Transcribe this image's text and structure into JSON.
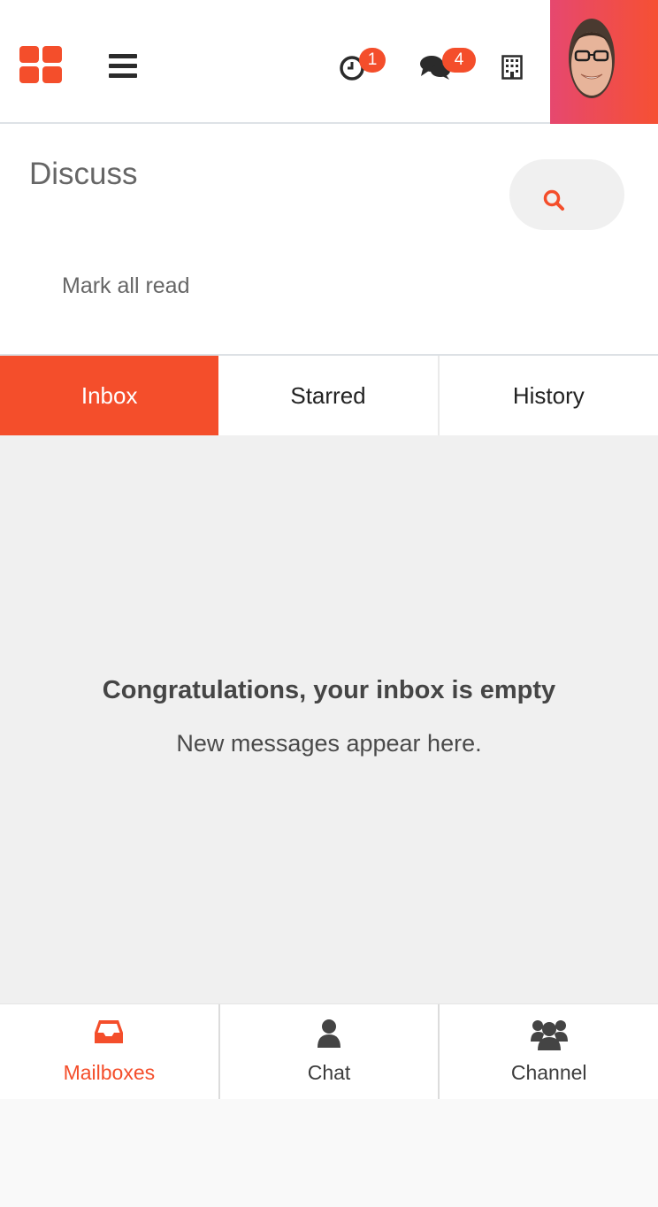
{
  "navbar": {
    "apps_icon": "apps-grid-icon",
    "menu_icon": "hamburger-icon",
    "activity": {
      "icon": "clock-icon",
      "count": "1"
    },
    "messaging": {
      "icon": "comments-icon",
      "count": "4"
    },
    "company_icon": "building-icon",
    "avatar": "user-avatar"
  },
  "control_panel": {
    "title": "Discuss",
    "search_icon": "search-icon",
    "mark_all_read": "Mark all read"
  },
  "tabs": [
    {
      "label": "Inbox",
      "active": true
    },
    {
      "label": "Starred",
      "active": false
    },
    {
      "label": "History",
      "active": false
    }
  ],
  "empty_state": {
    "title": "Congratulations, your inbox is empty",
    "subtitle": "New messages appear here."
  },
  "bottom_nav": [
    {
      "label": "Mailboxes",
      "icon": "inbox-icon",
      "active": true
    },
    {
      "label": "Chat",
      "icon": "user-icon",
      "active": false
    },
    {
      "label": "Channel",
      "icon": "users-icon",
      "active": false
    }
  ],
  "colors": {
    "accent": "#f44e2b",
    "avatar_gradient_start": "#e6486f",
    "avatar_gradient_end": "#f65033",
    "content_bg": "#f0f0f0"
  }
}
